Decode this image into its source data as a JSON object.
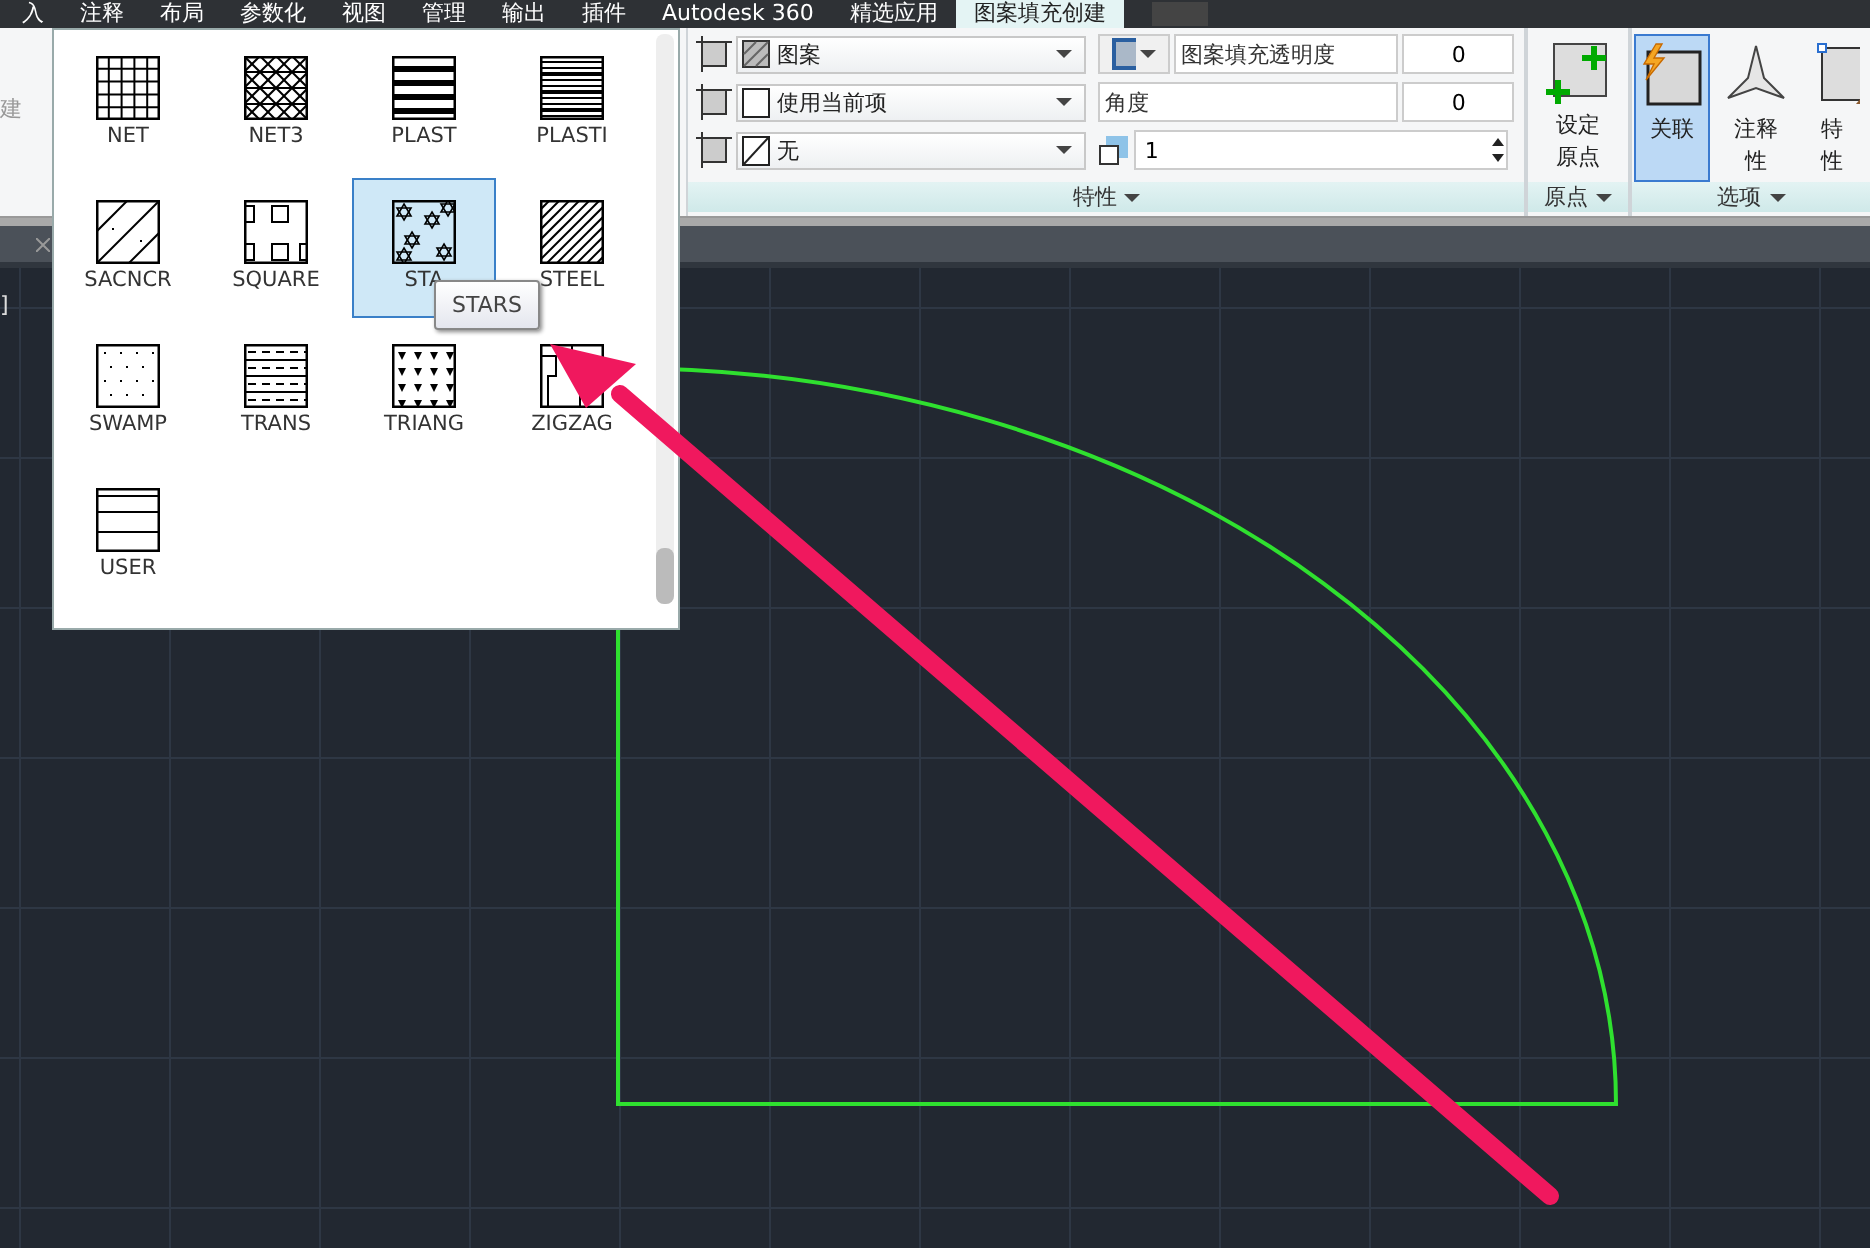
{
  "menu_tabs": [
    {
      "label": "入",
      "selected": false
    },
    {
      "label": "注释",
      "selected": false
    },
    {
      "label": "布局",
      "selected": false
    },
    {
      "label": "参数化",
      "selected": false
    },
    {
      "label": "视图",
      "selected": false
    },
    {
      "label": "管理",
      "selected": false
    },
    {
      "label": "输出",
      "selected": false
    },
    {
      "label": "插件",
      "selected": false
    },
    {
      "label": "Autodesk 360",
      "selected": false
    },
    {
      "label": "精选应用",
      "selected": false
    },
    {
      "label": "图案填充创建",
      "selected": true
    }
  ],
  "ribbon": {
    "left_panel_text": "建",
    "properties": {
      "pattern_type": "图案",
      "hatch_color": "使用当前项",
      "background": "无",
      "transparency_label": "图案填充透明度",
      "transparency": "0",
      "angle_label": "角度",
      "angle": "0",
      "scale": "1",
      "title": "特性"
    },
    "origin": {
      "button": "设定原点",
      "title": "原点"
    },
    "options": {
      "buttons": [
        {
          "label": "关联",
          "selected": true,
          "kind": "associative"
        },
        {
          "label": "注释性",
          "selected": false,
          "kind": "annotative"
        },
        {
          "label": "特性",
          "selected": false,
          "kind": "match"
        }
      ],
      "title": "选项"
    }
  },
  "viewport_label": "]",
  "gallery": {
    "items": [
      {
        "label": "NET",
        "kind": "grid",
        "selected": false
      },
      {
        "label": "NET3",
        "kind": "lattice",
        "selected": false
      },
      {
        "label": "PLAST",
        "kind": "bands",
        "selected": false
      },
      {
        "label": "PLASTI",
        "kind": "stripes",
        "selected": false
      },
      {
        "label": "SACNCR",
        "kind": "sparse",
        "selected": false
      },
      {
        "label": "SQUARE",
        "kind": "squares",
        "selected": false
      },
      {
        "label": "STA",
        "kind": "stars",
        "selected": true
      },
      {
        "label": "STEEL",
        "kind": "hatch",
        "selected": false
      },
      {
        "label": "SWAMP",
        "kind": "dots",
        "selected": false
      },
      {
        "label": "TRANS",
        "kind": "dashes",
        "selected": false
      },
      {
        "label": "TRIANG",
        "kind": "triangles",
        "selected": false
      },
      {
        "label": "ZIGZAG",
        "kind": "zigzag",
        "selected": false
      },
      {
        "label": "USER",
        "kind": "lines",
        "selected": false
      }
    ],
    "tooltip": "STARS"
  }
}
